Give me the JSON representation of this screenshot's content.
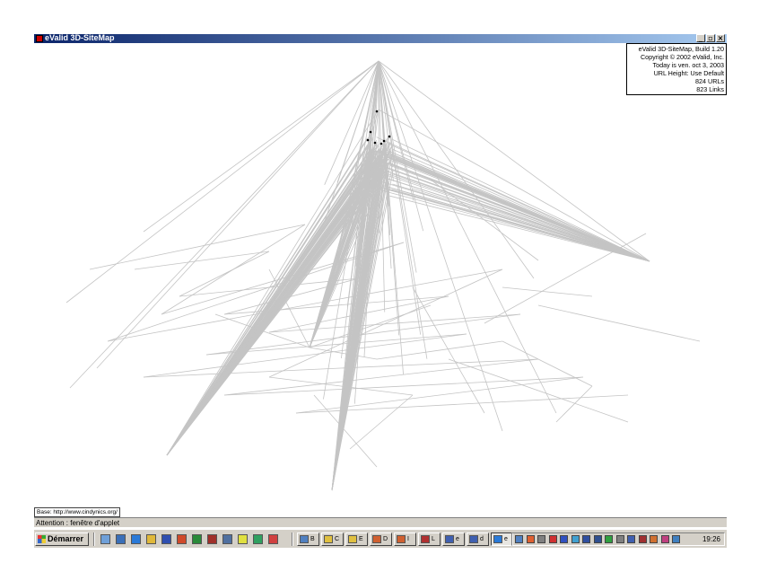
{
  "window": {
    "title": "eValid 3D-SiteMap",
    "buttons": [
      "_",
      "▫",
      "×"
    ]
  },
  "info": {
    "lines": [
      "eValid 3D-SiteMap, Build 1.20",
      "Copyright © 2002 eValid, Inc.",
      "Today is ven. oct 3, 2003",
      "URL Height: Use Default",
      "824 URLs",
      "823 Links"
    ]
  },
  "base_label": "Base: http://www.cindynics.org/",
  "status_text": "Attention : fenêtre d'applet",
  "taskbar": {
    "start_label": "Démarrer",
    "clock": "19:26",
    "quick_icons": [
      {
        "name": "desktop-icon",
        "color": "#6fa0d8"
      },
      {
        "name": "mail-icon",
        "color": "#3a6fb8"
      },
      {
        "name": "ie-icon",
        "color": "#2a7ad8"
      },
      {
        "name": "outlook-icon",
        "color": "#e0b83a"
      },
      {
        "name": "word-icon",
        "color": "#2f4fb0"
      },
      {
        "name": "powerpoint-icon",
        "color": "#d04a2a"
      },
      {
        "name": "excel-icon",
        "color": "#2a8a3a"
      },
      {
        "name": "access-icon",
        "color": "#a0302a"
      },
      {
        "name": "app-icon",
        "color": "#5070a0"
      },
      {
        "name": "paint-icon",
        "color": "#e0e040"
      },
      {
        "name": "globe-icon",
        "color": "#30a060"
      },
      {
        "name": "media-icon",
        "color": "#d04040"
      }
    ],
    "task_buttons": [
      {
        "name": "task-button-1",
        "label": "B",
        "color": "#5080c0"
      },
      {
        "name": "task-button-2",
        "label": "C",
        "color": "#e0c040"
      },
      {
        "name": "task-button-3",
        "label": "E",
        "color": "#e0c040"
      },
      {
        "name": "task-button-4",
        "label": "D",
        "color": "#d06030"
      },
      {
        "name": "task-button-5",
        "label": "I",
        "color": "#d06030"
      },
      {
        "name": "task-button-6",
        "label": "L",
        "color": "#b03030"
      },
      {
        "name": "task-button-7",
        "label": "e",
        "color": "#4060b0"
      },
      {
        "name": "task-button-8",
        "label": "d",
        "color": "#4060b0"
      },
      {
        "name": "task-button-9",
        "label": "e",
        "color": "#2a7ad8"
      }
    ],
    "tray_icons": [
      {
        "name": "tray-icon-1",
        "color": "#5080c0"
      },
      {
        "name": "tray-icon-2",
        "color": "#e06030"
      },
      {
        "name": "tray-icon-3",
        "color": "#808080"
      },
      {
        "name": "tray-icon-4",
        "color": "#d03030"
      },
      {
        "name": "tray-icon-5",
        "color": "#3050c0"
      },
      {
        "name": "tray-icon-6",
        "color": "#40a0d0"
      },
      {
        "name": "tray-icon-7",
        "color": "#3050a0"
      },
      {
        "name": "tray-icon-8",
        "color": "#305090"
      },
      {
        "name": "tray-icon-9",
        "color": "#30a040"
      },
      {
        "name": "tray-icon-10",
        "color": "#808080"
      },
      {
        "name": "tray-icon-11",
        "color": "#4060b0"
      },
      {
        "name": "tray-icon-12",
        "color": "#a03030"
      },
      {
        "name": "tray-icon-13",
        "color": "#d07030"
      },
      {
        "name": "tray-icon-14",
        "color": "#c04080"
      },
      {
        "name": "tray-icon-15",
        "color": "#4080c0"
      }
    ]
  },
  "colors": {
    "graph_line": "#c4c4c4",
    "title_bar_start": "#0a246a",
    "title_bar_end": "#a6caf0",
    "node": "#000000"
  }
}
